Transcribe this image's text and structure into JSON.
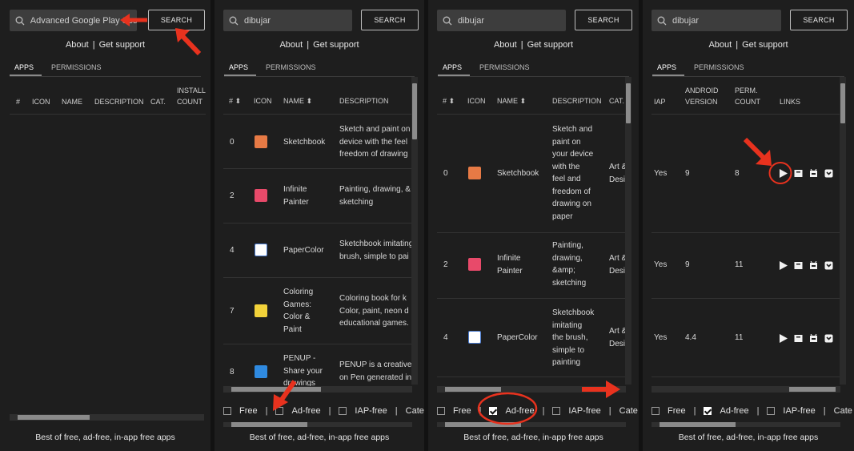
{
  "common": {
    "search_button": "SEARCH",
    "about": "About",
    "separator": "|",
    "support": "Get support",
    "tab_apps": "APPS",
    "tab_permissions": "PERMISSIONS",
    "footer": "Best of free, ad-free, in-app free apps",
    "filter_free": "Free",
    "filter_adfree": "Ad-free",
    "filter_iapfree": "IAP-free",
    "filter_categ": "Cate"
  },
  "panel1": {
    "search_value": "Advanced Google Play Sea",
    "headers": {
      "num": "#",
      "icon": "ICON",
      "name": "NAME",
      "description": "DESCRIPTION",
      "cat": "CAT.",
      "install": "INSTALL",
      "count": "COUNT"
    }
  },
  "panel2": {
    "search_value": "dibujar",
    "headers": {
      "num": "#",
      "icon": "ICON",
      "name": "NAME",
      "description": "DESCRIPTION"
    },
    "rows": [
      {
        "num": "0",
        "name": [
          "Sketchbook"
        ],
        "desc": [
          "Sketch and paint on",
          "device with the feel",
          "freedom of drawing"
        ]
      },
      {
        "num": "2",
        "name": [
          "Infinite",
          "Painter"
        ],
        "desc": [
          "Painting, drawing, &",
          "sketching"
        ]
      },
      {
        "num": "4",
        "name": [
          "PaperColor"
        ],
        "desc": [
          "Sketchbook imitating",
          "brush, simple to pai"
        ]
      },
      {
        "num": "7",
        "name": [
          "Coloring",
          "Games:",
          "Color &",
          "Paint"
        ],
        "desc": [
          "Coloring book for k",
          "Color, paint, neon d",
          "educational games."
        ]
      },
      {
        "num": "8",
        "name": [
          "PENUP -",
          "Share your",
          "drawings"
        ],
        "desc": [
          "PENUP is a creative",
          "on Pen generated in"
        ]
      }
    ]
  },
  "panel3": {
    "search_value": "dibujar",
    "headers": {
      "num": "#",
      "icon": "ICON",
      "name": "NAME",
      "description": "DESCRIPTION",
      "cat": "CAT."
    },
    "rows": [
      {
        "num": "0",
        "name": [
          "Sketchbook"
        ],
        "desc": [
          "Sketch and",
          "paint on",
          "your device",
          "with the",
          "feel and",
          "freedom of",
          "drawing on",
          "paper"
        ],
        "cat": [
          "Art &",
          "Desi"
        ]
      },
      {
        "num": "2",
        "name": [
          "Infinite",
          "Painter"
        ],
        "desc": [
          "Painting,",
          "drawing,",
          "&amp;",
          "sketching"
        ],
        "cat": [
          "Art &",
          "Desi"
        ]
      },
      {
        "num": "4",
        "name": [
          "PaperColor"
        ],
        "desc": [
          "Sketchbook",
          "imitating",
          "the brush,",
          "simple to",
          "painting"
        ],
        "cat": [
          "Art &",
          "Desi"
        ]
      }
    ]
  },
  "panel4": {
    "search_value": "dibujar",
    "headers": {
      "iap": "IAP",
      "android": "ANDROID",
      "version": "VERSION",
      "perm": "PERM.",
      "count": "COUNT",
      "links": "LINKS"
    },
    "rows": [
      {
        "iap": "Yes",
        "version": "9",
        "perm": "8"
      },
      {
        "iap": "Yes",
        "version": "9",
        "perm": "11"
      },
      {
        "iap": "Yes",
        "version": "4.4",
        "perm": "11"
      }
    ]
  },
  "colors": {
    "accent_arrow": "#e8321e",
    "panel_bg": "#1e1e1e",
    "page_bg": "#121212"
  }
}
